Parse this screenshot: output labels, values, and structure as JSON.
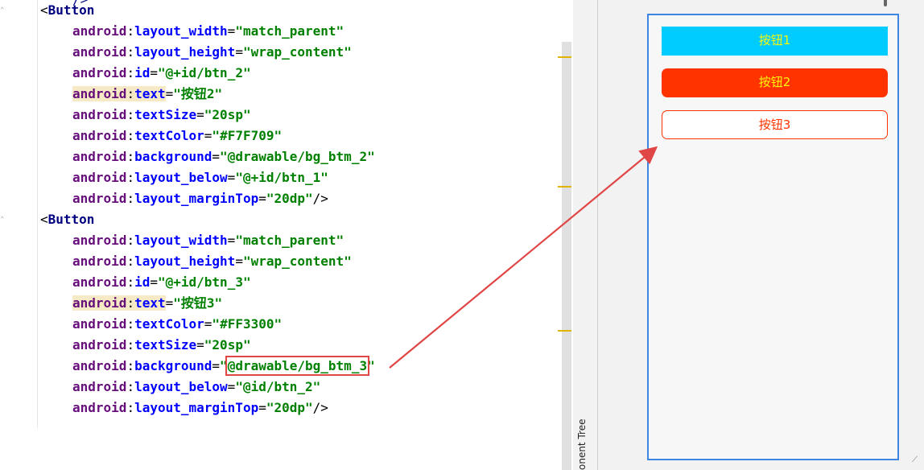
{
  "editor": {
    "top_fragment": "/>",
    "lines": [
      {
        "kind": "tag",
        "tag": "Button"
      },
      {
        "kind": "attr",
        "name": "layout_width",
        "value": "match_parent"
      },
      {
        "kind": "attr",
        "name": "layout_height",
        "value": "wrap_content"
      },
      {
        "kind": "attr",
        "name": "id",
        "value": "@+id/btn_2"
      },
      {
        "kind": "attr",
        "name": "text",
        "value": "按钮2",
        "highlight": true
      },
      {
        "kind": "attr",
        "name": "textSize",
        "value": "20sp"
      },
      {
        "kind": "attr",
        "name": "textColor",
        "value": "#F7F709"
      },
      {
        "kind": "attr",
        "name": "background",
        "value": "@drawable/bg_btm_2"
      },
      {
        "kind": "attr",
        "name": "layout_below",
        "value": "@+id/btn_1"
      },
      {
        "kind": "attr",
        "name": "layout_marginTop",
        "value": "20dp",
        "close": "/>"
      },
      {
        "kind": "tag",
        "tag": "Button"
      },
      {
        "kind": "attr",
        "name": "layout_width",
        "value": "match_parent"
      },
      {
        "kind": "attr",
        "name": "layout_height",
        "value": "wrap_content"
      },
      {
        "kind": "attr",
        "name": "id",
        "value": "@+id/btn_3"
      },
      {
        "kind": "attr",
        "name": "text",
        "value": "按钮3",
        "highlight": true
      },
      {
        "kind": "attr",
        "name": "textColor",
        "value": "#FF3300"
      },
      {
        "kind": "attr",
        "name": "textSize",
        "value": "20sp"
      },
      {
        "kind": "attr",
        "name": "background",
        "value": "@drawable/bg_btm_3",
        "boxed": true
      },
      {
        "kind": "attr",
        "name": "layout_below",
        "value": "@id/btn_2"
      },
      {
        "kind": "attr",
        "name": "layout_marginTop",
        "value": "20dp",
        "close": "/>"
      }
    ],
    "namespace": "android"
  },
  "preview": {
    "side_label": "onent Tree",
    "buttons": [
      {
        "label": "按钮1",
        "text_color": "#F7F709",
        "background": "#00CCFF"
      },
      {
        "label": "按钮2",
        "text_color": "#F7F709",
        "background": "#FF3300"
      },
      {
        "label": "按钮3",
        "text_color": "#FF3300",
        "background": "#FFFFFF"
      }
    ]
  },
  "colors": {
    "annotation": "#E04646",
    "selection_border": "#3F86E4",
    "highlight": "#F5E9C6"
  }
}
